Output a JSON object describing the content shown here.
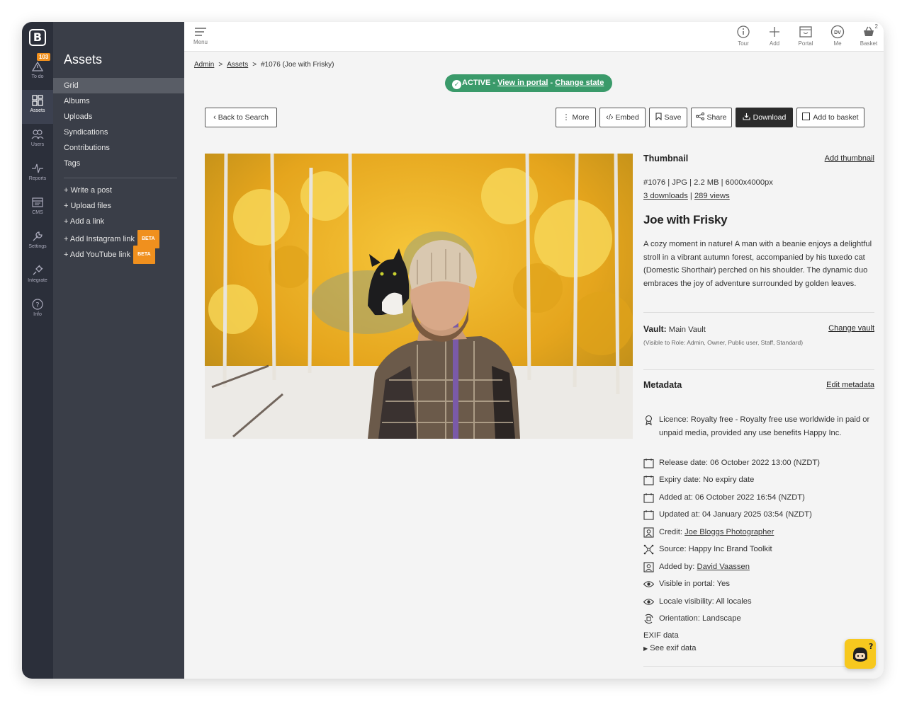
{
  "rail": {
    "logo": "B",
    "todo_badge": "103",
    "items": [
      {
        "label": "To do",
        "icon": "warning-icon"
      },
      {
        "label": "Assets",
        "icon": "grid-icon"
      },
      {
        "label": "Users",
        "icon": "users-icon"
      },
      {
        "label": "Reports",
        "icon": "pulse-icon"
      },
      {
        "label": "CMS",
        "icon": "cms-icon"
      },
      {
        "label": "Settings",
        "icon": "wrench-icon"
      },
      {
        "label": "Integrate",
        "icon": "plug-icon"
      },
      {
        "label": "Info",
        "icon": "question-icon"
      }
    ]
  },
  "subnav": {
    "title": "Assets",
    "items": [
      "Grid",
      "Albums",
      "Uploads",
      "Syndications",
      "Contributions",
      "Tags"
    ],
    "actions": [
      "+ Write a post",
      "+ Upload files",
      "+ Add a link",
      "+ Add Instagram link",
      "+ Add YouTube link"
    ],
    "beta_label": "BETA"
  },
  "topbar": {
    "menu_label": "Menu",
    "tour": "Tour",
    "add": "Add",
    "portal": "Portal",
    "me": "Me",
    "me_initials": "DV",
    "basket": "Basket",
    "basket_count": "2"
  },
  "breadcrumb": {
    "admin": "Admin",
    "assets": "Assets",
    "current": "#1076 (Joe with Frisky)",
    "sep": ">"
  },
  "status": {
    "state": "ACTIVE",
    "dash": "-",
    "view_link": "View in portal",
    "change_link": "Change state"
  },
  "toolbar": {
    "back": "Back to Search",
    "more": "More",
    "embed": "Embed",
    "save": "Save",
    "share": "Share",
    "download": "Download",
    "add_to_basket": "Add to basket"
  },
  "asset": {
    "thumbnail_label": "Thumbnail",
    "add_thumbnail": "Add thumbnail",
    "info_line": "#1076 | JPG | 2.2 MB | 6000x4000px",
    "downloads": "3 downloads",
    "views": "289 views",
    "title": "Joe with Frisky",
    "description": "A cozy moment in nature! A man with a beanie enjoys a delightful stroll in a vibrant autumn forest, accompanied by his tuxedo cat (Domestic Shorthair) perched on his shoulder. The dynamic duo embraces the joy of adventure surrounded by golden leaves.",
    "vault_label": "Vault:",
    "vault_value": "Main Vault",
    "change_vault": "Change vault",
    "vault_visibility": "(Visible to Role: Admin, Owner, Public user, Staff, Standard)",
    "metadata_label": "Metadata",
    "edit_metadata": "Edit metadata"
  },
  "metadata": {
    "licence": "Licence: Royalty free - Royalty free use worldwide in paid or unpaid media, provided any use benefits Happy Inc.",
    "release": "Release date: 06 October 2022 13:00 (NZDT)",
    "expiry": "Expiry date: No expiry date",
    "added_at": "Added at: 06 October 2022 16:54 (NZDT)",
    "updated_at": "Updated at: 04 January 2025 03:54 (NZDT)",
    "credit_label": "Credit:",
    "credit_value": "Joe Bloggs Photographer",
    "source": "Source: Happy Inc Brand Toolkit",
    "added_by_label": "Added by:",
    "added_by_value": "David Vaassen",
    "visible": "Visible in portal:  Yes",
    "locale": "Locale visibility:  All locales",
    "orientation": "Orientation:  Landscape",
    "exif_label": "EXIF data",
    "exif_toggle": "See exif data"
  },
  "colors": {
    "rail_bg": "#2b2f3a",
    "subnav_bg": "#3a3e48",
    "status_green": "#3a9a6a",
    "beta_orange": "#f0901e",
    "help_yellow": "#f7c81e"
  }
}
